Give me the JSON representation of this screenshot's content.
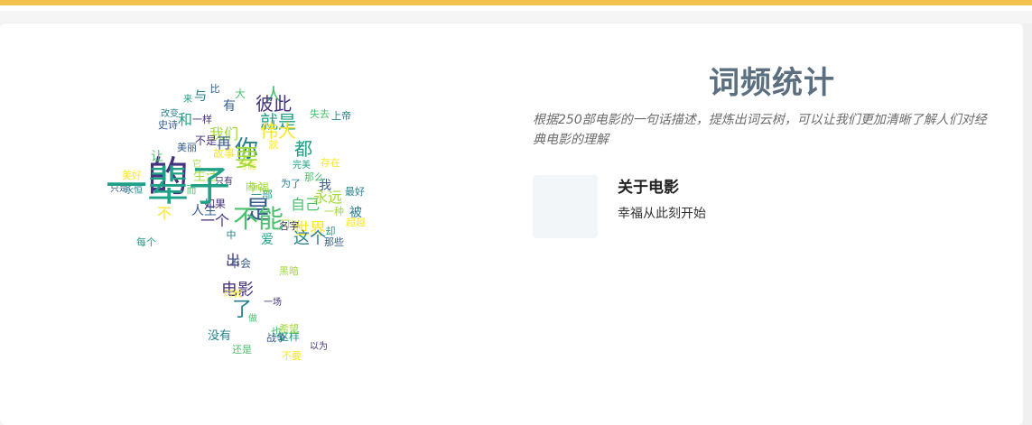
{
  "colors": {
    "accent_bar": "#f2c14e",
    "title": "#5b6f80",
    "word_palette": [
      "#46327e",
      "#365c8d",
      "#277f8e",
      "#1fa187",
      "#4ac16d",
      "#a0da39",
      "#fde725"
    ]
  },
  "header": {
    "title": "词频统计",
    "description": "根据250部电影的一句话描述，提炼出词云树，可以让我们更加清晰了解人们对经典电影的理解"
  },
  "about": {
    "title": "关于电影",
    "text": "幸福从此刻开始"
  },
  "word_cloud": {
    "shape": "tree",
    "words": [
      "的",
      "是",
      "你",
      "就是",
      "人",
      "我们",
      "世界",
      "电影",
      "人生",
      "了",
      "都",
      "自己",
      "永远",
      "不",
      "一个",
      "我",
      "被",
      "和",
      "让",
      "生活",
      "故事",
      "不是",
      "有",
      "与",
      "爱",
      "大",
      "可以",
      "就",
      "出",
      "不会",
      "没有",
      "这样",
      "也",
      "一种",
      "超越",
      "如果",
      "美丽",
      "为了",
      "一部",
      "那么",
      "幸福",
      "存在",
      "名字",
      "那些",
      "最好",
      "却",
      "还是",
      "内心",
      "美好",
      "一样",
      "史诗",
      "中",
      "每个",
      "而",
      "它",
      "可能",
      "只有",
      "比",
      "上帝",
      "完美",
      "失去",
      "黑暗",
      "时代",
      "一场",
      "战争",
      "改变",
      "来",
      "做",
      "希望",
      "不要",
      "以为",
      "只是",
      "永恒",
      "一辈子",
      "不能",
      "要",
      "伟大",
      "彼此",
      "再",
      "这个"
    ]
  }
}
